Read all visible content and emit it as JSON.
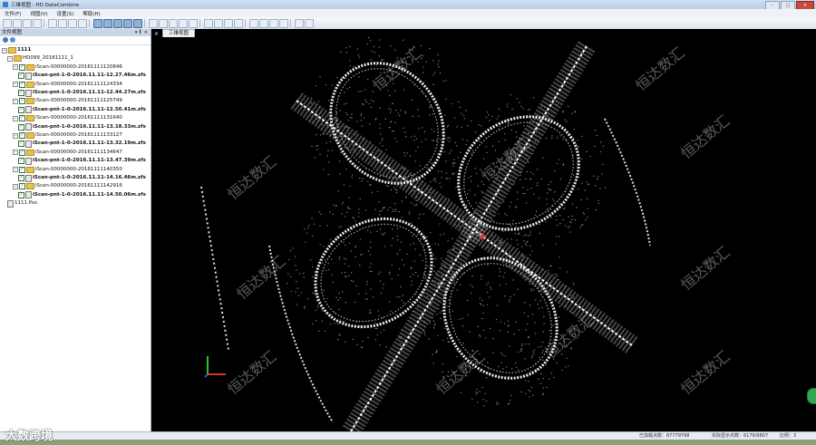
{
  "window": {
    "title": "三维视图 - HD DataCombine"
  },
  "menubar": {
    "items": [
      "文件(F)",
      "视图(V)",
      "设置(S)",
      "帮助(H)"
    ]
  },
  "toolbar": {
    "buttons": 28
  },
  "panel": {
    "title": "文件视图",
    "pin": "▾ ╀",
    "close": "×",
    "tree": [
      {
        "label": "1111",
        "level": 0,
        "bold": true,
        "icon": "folder"
      },
      {
        "label": "HD099_20181111_1",
        "level": 1,
        "bold": false,
        "icon": "folder"
      },
      {
        "label": "iScan-00000000-20161111120846",
        "level": 2,
        "bold": false,
        "icon": "folder"
      },
      {
        "label": "iScan-pnt-1-0-2016.11.11-12.27.46m.zfs",
        "level": 3,
        "bold": true,
        "icon": "file"
      },
      {
        "label": "iScan-00000000-20161111124334",
        "level": 2,
        "bold": false,
        "icon": "folder"
      },
      {
        "label": "iScan-pnt-1-0-2016.11.11-12.44.27m.zfs",
        "level": 3,
        "bold": true,
        "icon": "file"
      },
      {
        "label": "iScan-00000000-20161111125749",
        "level": 2,
        "bold": false,
        "icon": "folder"
      },
      {
        "label": "iScan-pnt-1-0-2016.11.11-12.50.41m.zfs",
        "level": 3,
        "bold": true,
        "icon": "file"
      },
      {
        "label": "iScan-00000000-20161111131640",
        "level": 2,
        "bold": false,
        "icon": "folder"
      },
      {
        "label": "iScan-pnt-1-0-2016.11.11-13.18.33m.zfs",
        "level": 3,
        "bold": true,
        "icon": "file"
      },
      {
        "label": "iScan-00000000-20161111133127",
        "level": 2,
        "bold": false,
        "icon": "folder"
      },
      {
        "label": "iScan-pnt-1-0-2016.11.11-13.32.19m.zfs",
        "level": 3,
        "bold": true,
        "icon": "file"
      },
      {
        "label": "iScan-00000000-20161111134647",
        "level": 2,
        "bold": false,
        "icon": "folder"
      },
      {
        "label": "iScan-pnt-1-0-2016.11.11-13.47.39m.zfs",
        "level": 3,
        "bold": true,
        "icon": "file"
      },
      {
        "label": "iScan-00000000-20161111140350",
        "level": 2,
        "bold": false,
        "icon": "folder"
      },
      {
        "label": "iScan-pnt-1-0-2016.11.11-14.16.46m.zfs",
        "level": 3,
        "bold": true,
        "icon": "file"
      },
      {
        "label": "iScan-00000000-20161111142916",
        "level": 2,
        "bold": false,
        "icon": "folder"
      },
      {
        "label": "iScan-pnt-1-0-2016.11.11-14.50.06m.zfs",
        "level": 3,
        "bold": true,
        "icon": "file"
      },
      {
        "label": "1111.Pos",
        "level": 1,
        "bold": false,
        "icon": "file"
      }
    ]
  },
  "viewport": {
    "tab_close": "×",
    "tab_label": "三维视图",
    "watermark_text": "恒达数汇",
    "axis_colors": {
      "x": "#e03030",
      "y": "#30c030",
      "z": "#3050e0"
    }
  },
  "statusbar": {
    "loaded_points": "已加载点数：87779798",
    "visible_points": "实际显示点数：6179/9807",
    "scale": "比例：3"
  },
  "corner_watermark": "大数跨境"
}
